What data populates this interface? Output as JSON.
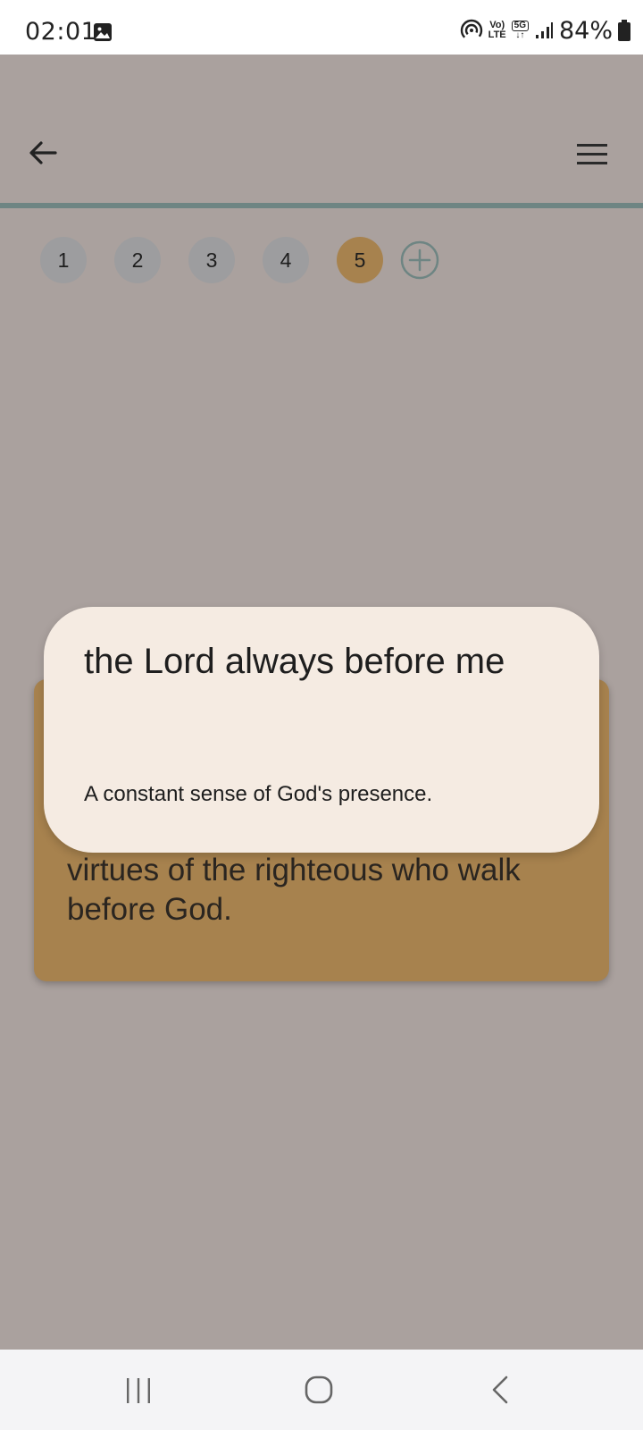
{
  "status_bar": {
    "time": "02:01",
    "battery": "84%",
    "lte_top": "Vo)",
    "lte_bottom": "LTE",
    "fiveg_label": "5G",
    "icons": [
      "gallery-icon",
      "hotspot-icon",
      "volte-icon",
      "5g-icon",
      "signal-icon",
      "battery-icon"
    ]
  },
  "app_bar": {
    "back_icon": "arrow-left-icon",
    "menu_icon": "hamburger-menu-icon"
  },
  "page_tabs": {
    "items": [
      {
        "label": "1",
        "active": false
      },
      {
        "label": "2",
        "active": false
      },
      {
        "label": "3",
        "active": false
      },
      {
        "label": "4",
        "active": false
      },
      {
        "label": "5",
        "active": true
      }
    ],
    "add_icon": "plus-circle-icon"
  },
  "card": {
    "visible_text": "virtues of the righteous who walk before God."
  },
  "popup": {
    "title": "the Lord always before me",
    "description": "A constant sense of God's presence."
  },
  "nav_bar": {
    "icons": [
      "recents-icon",
      "home-icon",
      "back-icon"
    ]
  },
  "colors": {
    "background": "#aaa19e",
    "accent": "#a7824e",
    "divider": "#6e8583",
    "popup_bg": "#f5ebe2",
    "tab_inactive": "#9d9d9f"
  }
}
